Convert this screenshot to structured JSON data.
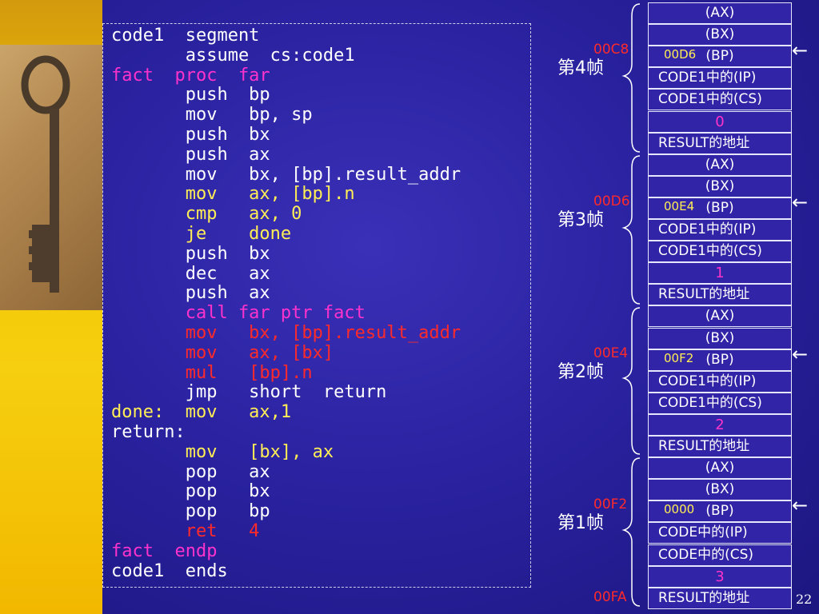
{
  "code_lines": [
    {
      "text": "code1  segment",
      "color": "white"
    },
    {
      "text": "       assume  cs:code1",
      "color": "white"
    },
    {
      "text": "fact  proc  far",
      "color": "magenta"
    },
    {
      "text": "       push  bp",
      "color": "white"
    },
    {
      "text": "       mov   bp, sp",
      "color": "white"
    },
    {
      "text": "       push  bx",
      "color": "white"
    },
    {
      "text": "       push  ax",
      "color": "white"
    },
    {
      "text": "       mov   bx, [bp].result_addr",
      "color": "white"
    },
    {
      "text": "       mov   ax, [bp].n",
      "color": "yellow"
    },
    {
      "text": "       cmp   ax, 0",
      "color": "yellow"
    },
    {
      "text": "       je    done",
      "color": "yellow"
    },
    {
      "text": "       push  bx",
      "color": "white"
    },
    {
      "text": "       dec   ax",
      "color": "white"
    },
    {
      "text": "       push  ax",
      "color": "white"
    },
    {
      "text": "       call far ptr fact",
      "color": "magenta"
    },
    {
      "text": "       mov   bx, [bp].result_addr",
      "color": "red"
    },
    {
      "text": "       mov   ax, [bx]",
      "color": "red"
    },
    {
      "text": "       mul   [bp].n",
      "color": "red"
    },
    {
      "text": "       jmp   short  return",
      "color": "white"
    },
    {
      "text": "done:  mov   ax,1",
      "color": "yellow"
    },
    {
      "text": "return:",
      "color": "white"
    },
    {
      "text": "       mov   [bx], ax",
      "color": "yellow"
    },
    {
      "text": "       pop   ax",
      "color": "white"
    },
    {
      "text": "       pop   bx",
      "color": "white"
    },
    {
      "text": "       pop   bp",
      "color": "white"
    },
    {
      "text": "       ret   4",
      "color": "red"
    },
    {
      "text": "fact  endp",
      "color": "magenta"
    },
    {
      "text": "code1  ends",
      "color": "white"
    }
  ],
  "stack": {
    "frames": [
      {
        "label": "第4帧",
        "addr": "00C8",
        "bp_value": "00D6",
        "cells": [
          "(AX)",
          "(BX)",
          "(BP)",
          "CODE1中的(IP)",
          "CODE1中的(CS)",
          "0",
          "RESULT的地址"
        ]
      },
      {
        "label": "第3帧",
        "addr": "00D6",
        "bp_value": "00E4",
        "cells": [
          "(AX)",
          "(BX)",
          "(BP)",
          "CODE1中的(IP)",
          "CODE1中的(CS)",
          "1",
          "RESULT的地址"
        ]
      },
      {
        "label": "第2帧",
        "addr": "00E4",
        "bp_value": "00F2",
        "cells": [
          "(AX)",
          "(BX)",
          "(BP)",
          "CODE1中的(IP)",
          "CODE1中的(CS)",
          "2",
          "RESULT的地址"
        ]
      },
      {
        "label": "第1帧",
        "addr": "00F2",
        "bp_value": "0000",
        "cells": [
          "(AX)",
          "(BX)",
          "(BP)",
          "CODE中的(IP)",
          "CODE中的(CS)",
          "3",
          "RESULT的地址"
        ]
      }
    ],
    "bottom_addr": "00FA",
    "arrow": "←"
  },
  "page_number": "22",
  "colors": {
    "white": "#ffffff",
    "magenta": "#ff33cc",
    "yellow": "#ffee55",
    "red": "#ff2a2a"
  }
}
